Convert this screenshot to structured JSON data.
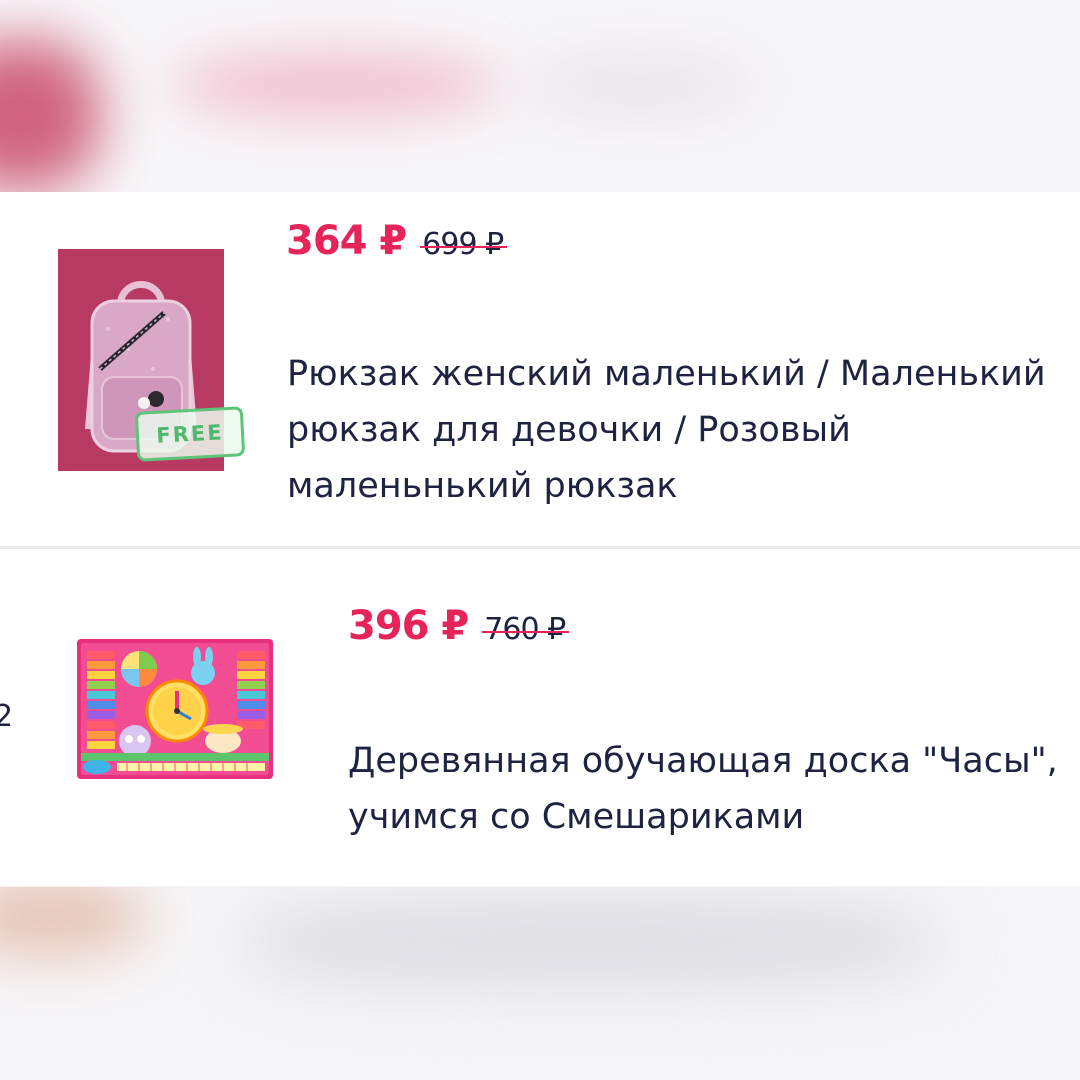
{
  "products": [
    {
      "price_current": "364 ₽",
      "price_old": "699 ₽",
      "badge": "FREE",
      "title_lines": [
        "Рюкзак женский маленький / Маленький",
        "рюкзак для девочки / Розовый",
        "маленьнький рюкзак"
      ],
      "image_icon": "pink-backpack-image"
    },
    {
      "price_current": "396 ₽",
      "price_old": "760 ₽",
      "title_lines": [
        "Деревянная обучающая доска \"Часы\",",
        "учимся со Смешариками"
      ],
      "image_icon": "wooden-clock-board-image",
      "side_mark": "2"
    }
  ],
  "colors": {
    "accent_price": "#e6245a",
    "text": "#1d2340",
    "badge_green": "#5dc47a",
    "backpack_bg": "#b83a63"
  }
}
